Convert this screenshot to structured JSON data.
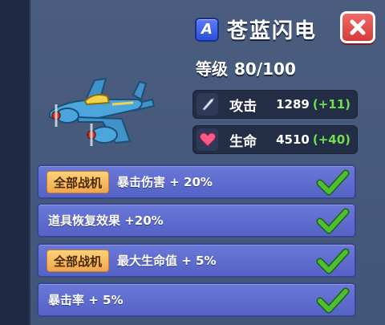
{
  "header": {
    "rarity": "A",
    "plane_name": "苍蓝闪电",
    "level_label": "等级",
    "level_value": "80/100"
  },
  "stats": [
    {
      "label": "攻击",
      "value": "1289",
      "bonus": "(+11)",
      "icon": "sword-icon"
    },
    {
      "label": "生命",
      "value": "4510",
      "bonus": "(+40)",
      "icon": "heart-icon"
    }
  ],
  "skills": [
    {
      "scope": "全部战机",
      "text": "暴击伤害 + 20%",
      "unlocked": true
    },
    {
      "scope": "",
      "text": "道具恢复效果 +20%",
      "unlocked": true
    },
    {
      "scope": "全部战机",
      "text": "最大生命值 + 5%",
      "unlocked": true
    },
    {
      "scope": "",
      "text": "暴击率 + 5%",
      "unlocked": true
    }
  ],
  "colors": {
    "bonus": "#6ee04b",
    "check": "#3fae2a",
    "close": "#d63b3a",
    "rarity": "#2c4fd8"
  }
}
